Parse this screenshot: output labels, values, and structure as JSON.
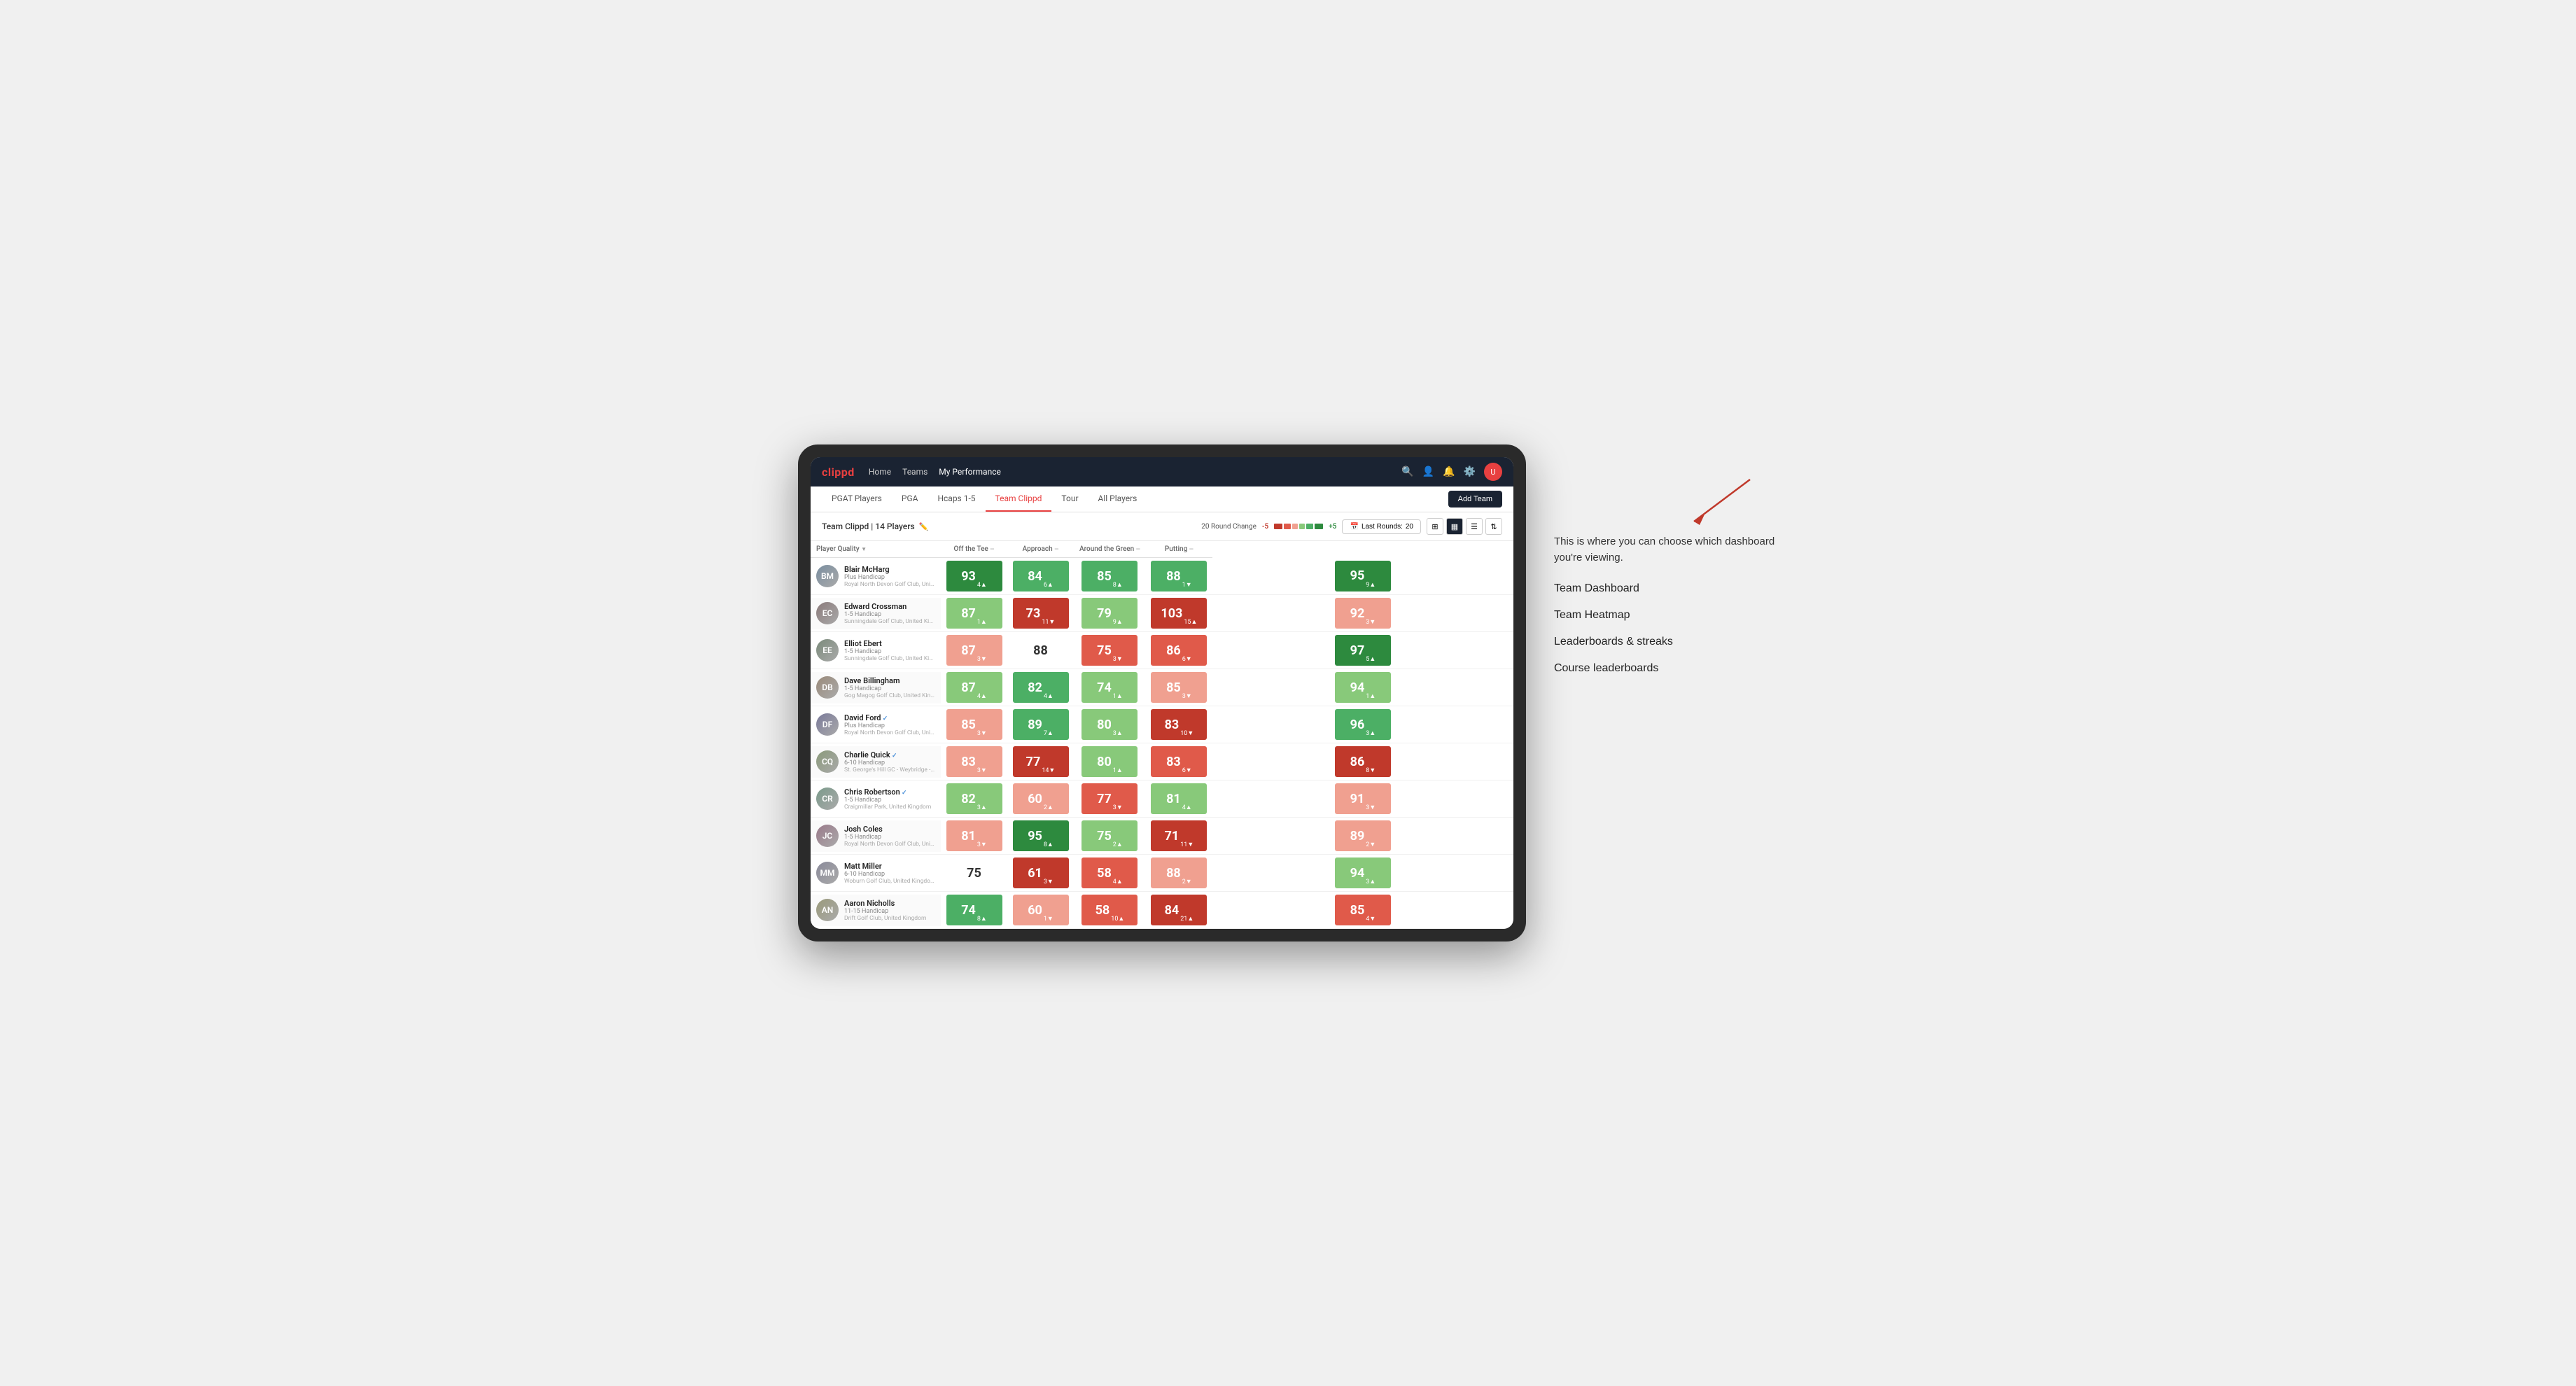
{
  "annotation": {
    "intro_text": "This is where you can choose which dashboard you're viewing.",
    "items": [
      "Team Dashboard",
      "Team Heatmap",
      "Leaderboards & streaks",
      "Course leaderboards"
    ]
  },
  "nav": {
    "logo": "clippd",
    "links": [
      {
        "label": "Home",
        "active": false
      },
      {
        "label": "Teams",
        "active": false
      },
      {
        "label": "My Performance",
        "active": true
      }
    ],
    "icons": [
      "search",
      "person",
      "bell",
      "settings",
      "avatar"
    ]
  },
  "sub_nav": {
    "tabs": [
      {
        "label": "PGAT Players",
        "active": false
      },
      {
        "label": "PGA",
        "active": false
      },
      {
        "label": "Hcaps 1-5",
        "active": false
      },
      {
        "label": "Team Clippd",
        "active": true
      },
      {
        "label": "Tour",
        "active": false
      },
      {
        "label": "All Players",
        "active": false
      }
    ],
    "add_team_label": "Add Team"
  },
  "team_header": {
    "team_name": "Team Clippd",
    "player_count": "14 Players",
    "round_change_label": "20 Round Change",
    "round_change_min": "-5",
    "round_change_max": "+5",
    "last_rounds_label": "Last Rounds:",
    "last_rounds_value": "20"
  },
  "table": {
    "columns": [
      {
        "label": "Player Quality",
        "sort": true
      },
      {
        "label": "Off the Tee",
        "sort": true
      },
      {
        "label": "Approach",
        "sort": true
      },
      {
        "label": "Around the Green",
        "sort": true
      },
      {
        "label": "Putting",
        "sort": true
      }
    ],
    "players": [
      {
        "name": "Blair McHarg",
        "handicap": "Plus Handicap",
        "club": "Royal North Devon Golf Club, United Kingdom",
        "initials": "BM",
        "scores": [
          {
            "value": "93",
            "delta": "4",
            "dir": "up",
            "color": "green-dark"
          },
          {
            "value": "84",
            "delta": "6",
            "dir": "up",
            "color": "green-med"
          },
          {
            "value": "85",
            "delta": "8",
            "dir": "up",
            "color": "green-med"
          },
          {
            "value": "88",
            "delta": "1",
            "dir": "down",
            "color": "green-med"
          },
          {
            "value": "95",
            "delta": "9",
            "dir": "up",
            "color": "green-dark"
          }
        ]
      },
      {
        "name": "Edward Crossman",
        "handicap": "1-5 Handicap",
        "club": "Sunningdale Golf Club, United Kingdom",
        "initials": "EC",
        "scores": [
          {
            "value": "87",
            "delta": "1",
            "dir": "up",
            "color": "green-light"
          },
          {
            "value": "73",
            "delta": "11",
            "dir": "down",
            "color": "red-dark"
          },
          {
            "value": "79",
            "delta": "9",
            "dir": "up",
            "color": "green-light"
          },
          {
            "value": "103",
            "delta": "15",
            "dir": "up",
            "color": "red-dark"
          },
          {
            "value": "92",
            "delta": "3",
            "dir": "down",
            "color": "red-light"
          }
        ]
      },
      {
        "name": "Elliot Ebert",
        "handicap": "1-5 Handicap",
        "club": "Sunningdale Golf Club, United Kingdom",
        "initials": "EE",
        "scores": [
          {
            "value": "87",
            "delta": "3",
            "dir": "down",
            "color": "red-light"
          },
          {
            "value": "88",
            "delta": "",
            "dir": "",
            "color": "neutral"
          },
          {
            "value": "75",
            "delta": "3",
            "dir": "down",
            "color": "red-med"
          },
          {
            "value": "86",
            "delta": "6",
            "dir": "down",
            "color": "red-med"
          },
          {
            "value": "97",
            "delta": "5",
            "dir": "up",
            "color": "green-dark"
          }
        ]
      },
      {
        "name": "Dave Billingham",
        "handicap": "1-5 Handicap",
        "club": "Gog Magog Golf Club, United Kingdom",
        "initials": "DB",
        "scores": [
          {
            "value": "87",
            "delta": "4",
            "dir": "up",
            "color": "green-light"
          },
          {
            "value": "82",
            "delta": "4",
            "dir": "up",
            "color": "green-med"
          },
          {
            "value": "74",
            "delta": "1",
            "dir": "up",
            "color": "green-light"
          },
          {
            "value": "85",
            "delta": "3",
            "dir": "down",
            "color": "red-light"
          },
          {
            "value": "94",
            "delta": "1",
            "dir": "up",
            "color": "green-light"
          }
        ]
      },
      {
        "name": "David Ford",
        "handicap": "Plus Handicap",
        "club": "Royal North Devon Golf Club, United Kingdom",
        "initials": "DF",
        "verified": true,
        "scores": [
          {
            "value": "85",
            "delta": "3",
            "dir": "down",
            "color": "red-light"
          },
          {
            "value": "89",
            "delta": "7",
            "dir": "up",
            "color": "green-med"
          },
          {
            "value": "80",
            "delta": "3",
            "dir": "up",
            "color": "green-light"
          },
          {
            "value": "83",
            "delta": "10",
            "dir": "down",
            "color": "red-dark"
          },
          {
            "value": "96",
            "delta": "3",
            "dir": "up",
            "color": "green-med"
          }
        ]
      },
      {
        "name": "Charlie Quick",
        "handicap": "6-10 Handicap",
        "club": "St. George's Hill GC - Weybridge - Surrey, Uni...",
        "initials": "CQ",
        "verified": true,
        "scores": [
          {
            "value": "83",
            "delta": "3",
            "dir": "down",
            "color": "red-light"
          },
          {
            "value": "77",
            "delta": "14",
            "dir": "down",
            "color": "red-dark"
          },
          {
            "value": "80",
            "delta": "1",
            "dir": "up",
            "color": "green-light"
          },
          {
            "value": "83",
            "delta": "6",
            "dir": "down",
            "color": "red-med"
          },
          {
            "value": "86",
            "delta": "8",
            "dir": "down",
            "color": "red-dark"
          }
        ]
      },
      {
        "name": "Chris Robertson",
        "handicap": "1-5 Handicap",
        "club": "Craigmillar Park, United Kingdom",
        "initials": "CR",
        "verified": true,
        "scores": [
          {
            "value": "82",
            "delta": "3",
            "dir": "up",
            "color": "green-light"
          },
          {
            "value": "60",
            "delta": "2",
            "dir": "up",
            "color": "red-light"
          },
          {
            "value": "77",
            "delta": "3",
            "dir": "down",
            "color": "red-med"
          },
          {
            "value": "81",
            "delta": "4",
            "dir": "up",
            "color": "green-light"
          },
          {
            "value": "91",
            "delta": "3",
            "dir": "down",
            "color": "red-light"
          }
        ]
      },
      {
        "name": "Josh Coles",
        "handicap": "1-5 Handicap",
        "club": "Royal North Devon Golf Club, United Kingdom",
        "initials": "JC",
        "scores": [
          {
            "value": "81",
            "delta": "3",
            "dir": "down",
            "color": "red-light"
          },
          {
            "value": "95",
            "delta": "8",
            "dir": "up",
            "color": "green-dark"
          },
          {
            "value": "75",
            "delta": "2",
            "dir": "up",
            "color": "green-light"
          },
          {
            "value": "71",
            "delta": "11",
            "dir": "down",
            "color": "red-dark"
          },
          {
            "value": "89",
            "delta": "2",
            "dir": "down",
            "color": "red-light"
          }
        ]
      },
      {
        "name": "Matt Miller",
        "handicap": "6-10 Handicap",
        "club": "Woburn Golf Club, United Kingdom",
        "initials": "MM",
        "scores": [
          {
            "value": "75",
            "delta": "",
            "dir": "",
            "color": "neutral"
          },
          {
            "value": "61",
            "delta": "3",
            "dir": "down",
            "color": "red-dark"
          },
          {
            "value": "58",
            "delta": "4",
            "dir": "up",
            "color": "red-med"
          },
          {
            "value": "88",
            "delta": "2",
            "dir": "down",
            "color": "red-light"
          },
          {
            "value": "94",
            "delta": "3",
            "dir": "up",
            "color": "green-light"
          }
        ]
      },
      {
        "name": "Aaron Nicholls",
        "handicap": "11-15 Handicap",
        "club": "Drift Golf Club, United Kingdom",
        "initials": "AN",
        "scores": [
          {
            "value": "74",
            "delta": "8",
            "dir": "up",
            "color": "green-med"
          },
          {
            "value": "60",
            "delta": "1",
            "dir": "down",
            "color": "red-light"
          },
          {
            "value": "58",
            "delta": "10",
            "dir": "up",
            "color": "red-med"
          },
          {
            "value": "84",
            "delta": "21",
            "dir": "up",
            "color": "red-dark"
          },
          {
            "value": "85",
            "delta": "4",
            "dir": "down",
            "color": "red-med"
          }
        ]
      }
    ]
  }
}
